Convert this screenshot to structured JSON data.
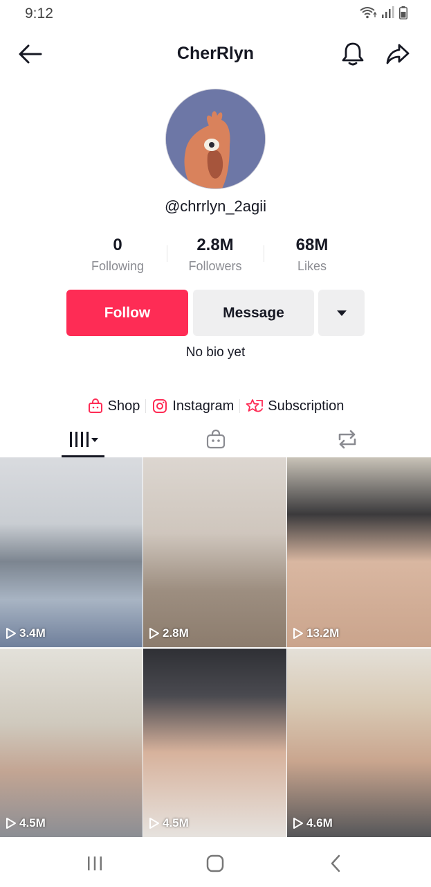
{
  "status_bar": {
    "time": "9:12"
  },
  "header": {
    "title": "CherRlyn"
  },
  "profile": {
    "username": "@chrrlyn_2agii",
    "stats": [
      {
        "value": "0",
        "label": "Following"
      },
      {
        "value": "2.8M",
        "label": "Followers"
      },
      {
        "value": "68M",
        "label": "Likes"
      }
    ],
    "follow_label": "Follow",
    "message_label": "Message",
    "bio": "No bio yet"
  },
  "links": [
    {
      "label": "Shop",
      "icon": "shop-bag-icon"
    },
    {
      "label": "Instagram",
      "icon": "instagram-icon"
    },
    {
      "label": "Subscription",
      "icon": "subscription-icon"
    }
  ],
  "tabs": [
    {
      "name": "videos",
      "icon": "grid-videos-icon",
      "selected": true
    },
    {
      "name": "shop",
      "icon": "shop-bag-icon"
    },
    {
      "name": "reposts",
      "icon": "repost-icon"
    }
  ],
  "videos": [
    {
      "views": "3.4M"
    },
    {
      "views": "2.8M"
    },
    {
      "views": "13.2M"
    },
    {
      "views": "4.5M"
    },
    {
      "views": "4.5M"
    },
    {
      "views": "4.6M"
    }
  ],
  "colors": {
    "accent": "#fe2c55",
    "button_gray": "#efeff0",
    "text": "#161823",
    "muted": "#8a8b91"
  }
}
